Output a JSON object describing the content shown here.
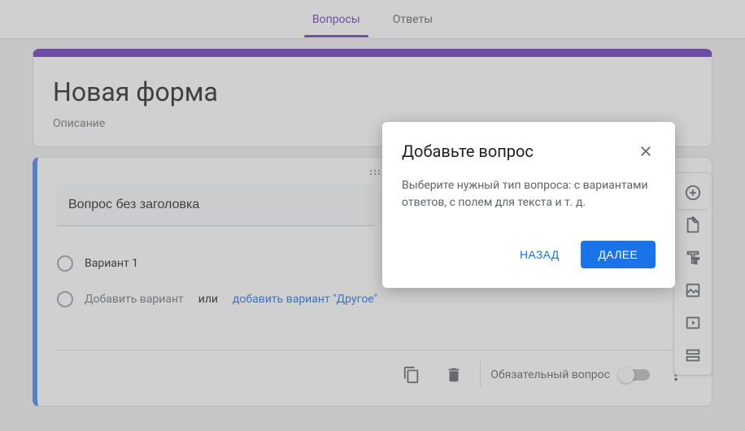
{
  "tabs": {
    "questions": "Вопросы",
    "responses": "Ответы"
  },
  "form": {
    "title": "Новая форма",
    "description": "Описание"
  },
  "question": {
    "title": "Вопрос без заголовка",
    "option1": "Вариант 1",
    "add_option": "Добавить вариант",
    "or": "или",
    "add_other": "добавить вариант \"Другое\"",
    "required_label": "Обязательный вопрос"
  },
  "dialog": {
    "title": "Добавьте вопрос",
    "body": "Выберите нужный тип вопроса: с вариантами ответов, с полем для текста и т. д.",
    "back": "НАЗАД",
    "next": "ДАЛЕЕ"
  }
}
